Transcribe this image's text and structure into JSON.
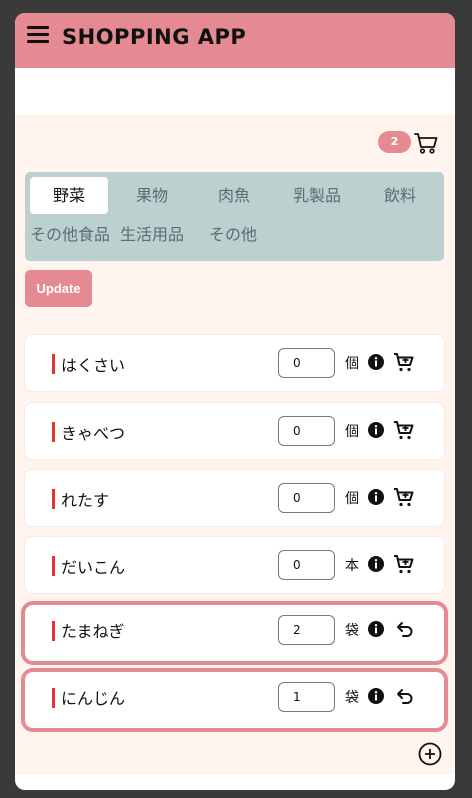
{
  "header": {
    "title": "SHOPPING APP",
    "menu_icon": "hamburger-menu-icon",
    "color": "#e58a93"
  },
  "cart": {
    "badge_count": "2",
    "icon": "cart-icon"
  },
  "tabs": [
    {
      "label": "野菜",
      "active": true
    },
    {
      "label": "果物"
    },
    {
      "label": "肉魚"
    },
    {
      "label": "乳製品"
    },
    {
      "label": "飲料"
    },
    {
      "label": "その他食品"
    },
    {
      "label": "生活用品"
    },
    {
      "label": "その他"
    }
  ],
  "update_label": "Update",
  "items": [
    {
      "name": "はくさい",
      "qty": "0",
      "unit": "個",
      "action_icon": "add-to-cart-icon"
    },
    {
      "name": "きゃべつ",
      "qty": "0",
      "unit": "個",
      "action_icon": "add-to-cart-icon"
    },
    {
      "name": "れたす",
      "qty": "0",
      "unit": "個",
      "action_icon": "add-to-cart-icon"
    },
    {
      "name": "だいこん",
      "qty": "0",
      "unit": "本",
      "action_icon": "add-to-cart-icon"
    },
    {
      "name": "たまねぎ",
      "qty": "2",
      "unit": "袋",
      "action_icon": "undo-icon",
      "in_cart": true
    },
    {
      "name": "にんじん",
      "qty": "1",
      "unit": "袋",
      "action_icon": "undo-icon",
      "in_cart": true
    }
  ],
  "add_icon": "add-circle-icon",
  "colors": {
    "accent": "#e58a93",
    "tab_bg": "#bcd0d0",
    "content_bg": "#fff5ee",
    "marker": "#e0342f"
  }
}
